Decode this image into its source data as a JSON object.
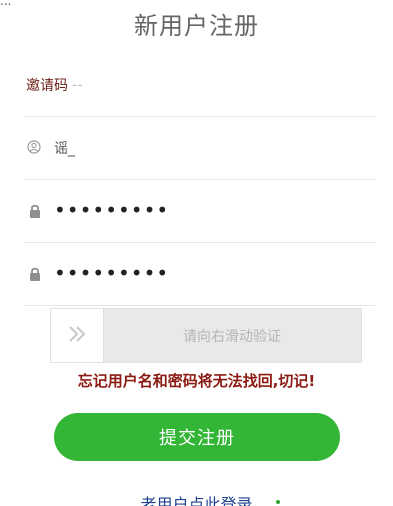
{
  "header": {
    "corner_text": "...",
    "title": "新用户注册"
  },
  "form": {
    "invite": {
      "label": "邀请码",
      "value": "--"
    },
    "username": {
      "value": "谣_"
    },
    "password": {
      "value": "•••••••••"
    },
    "confirm_password": {
      "value": "•••••••••"
    }
  },
  "slider": {
    "text": "请向右滑动验证",
    "handle_icon": "double-chevron-right-icon"
  },
  "warning": {
    "text": "忘记用户名和密码将无法找回,切记!"
  },
  "actions": {
    "submit_label": "提交注册",
    "existing_user_label": "老用户点此登录"
  },
  "icons": {
    "username": "user-icon",
    "password": "lock-icon"
  },
  "colors": {
    "title": "#666666",
    "invite_label": "#6b1f14",
    "warning": "#8b1a12",
    "submit_bg": "#33b536",
    "link": "#1f3f8f"
  }
}
